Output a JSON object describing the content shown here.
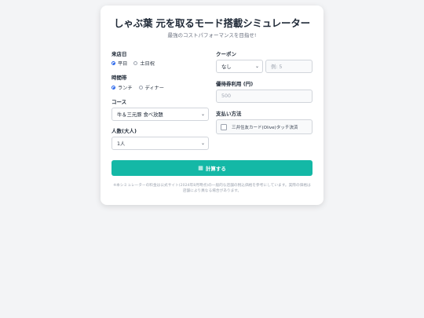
{
  "header": {
    "title": "しゃぶ葉 元を取るモード搭載シミュレーター",
    "subtitle": "最強のコストパフォーマンスを目指せ!"
  },
  "visit_day": {
    "label": "来店日",
    "options": [
      {
        "label": "平日",
        "selected": true
      },
      {
        "label": "土日祝",
        "selected": false
      }
    ]
  },
  "time_slot": {
    "label": "時間帯",
    "options": [
      {
        "label": "ランチ",
        "selected": true
      },
      {
        "label": "ディナー",
        "selected": false
      }
    ]
  },
  "course": {
    "label": "コース",
    "value": "牛＆三元豚 食べ放題"
  },
  "people": {
    "label": "人数(大人)",
    "value": "1人"
  },
  "coupon": {
    "label": "クーポン",
    "value": "なし",
    "input_placeholder": "例: 5"
  },
  "voucher": {
    "label": "優待券利用 (円)",
    "placeholder": "500"
  },
  "payment": {
    "label": "支払い方法",
    "option_label": "三井住友カード(Olive)タッチ決済",
    "checked": false
  },
  "calculate_button": {
    "icon": "calculator-icon",
    "label": "計算する"
  },
  "footnote": "※本シミュレーターの料金は公式サイト(2024年8月時点)の一般的な店舗の税込価格を参考にしています。実際の価格は店舗により異なる場合があります。",
  "colors": {
    "accent": "#14b8a6",
    "radio": "#2563eb"
  }
}
